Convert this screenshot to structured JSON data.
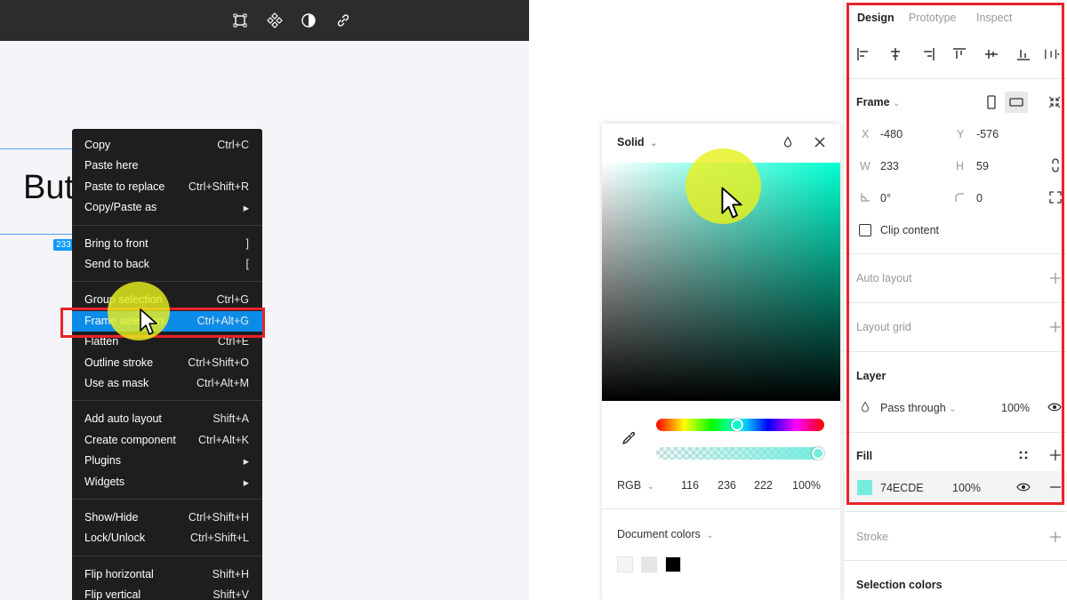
{
  "canvas": {
    "text": "But",
    "size_badge": "233"
  },
  "context_menu": {
    "groups": [
      [
        {
          "label": "Copy",
          "shortcut": "Ctrl+C"
        },
        {
          "label": "Paste here",
          "shortcut": ""
        },
        {
          "label": "Paste to replace",
          "shortcut": "Ctrl+Shift+R"
        },
        {
          "label": "Copy/Paste as",
          "shortcut": "▸"
        }
      ],
      [
        {
          "label": "Bring to front",
          "shortcut": "]"
        },
        {
          "label": "Send to back",
          "shortcut": "["
        }
      ],
      [
        {
          "label": "Group selection",
          "shortcut": "Ctrl+G"
        },
        {
          "label": "Frame selection",
          "shortcut": "Ctrl+Alt+G"
        },
        {
          "label": "Flatten",
          "shortcut": "Ctrl+E"
        },
        {
          "label": "Outline stroke",
          "shortcut": "Ctrl+Shift+O"
        },
        {
          "label": "Use as mask",
          "shortcut": "Ctrl+Alt+M"
        }
      ],
      [
        {
          "label": "Add auto layout",
          "shortcut": "Shift+A"
        },
        {
          "label": "Create component",
          "shortcut": "Ctrl+Alt+K"
        },
        {
          "label": "Plugins",
          "shortcut": "▸"
        },
        {
          "label": "Widgets",
          "shortcut": "▸"
        }
      ],
      [
        {
          "label": "Show/Hide",
          "shortcut": "Ctrl+Shift+H"
        },
        {
          "label": "Lock/Unlock",
          "shortcut": "Ctrl+Shift+L"
        }
      ],
      [
        {
          "label": "Flip horizontal",
          "shortcut": "Shift+H"
        },
        {
          "label": "Flip vertical",
          "shortcut": "Shift+V"
        }
      ]
    ],
    "highlighted": "Frame selection"
  },
  "color_picker": {
    "mode": "Solid",
    "color_model": "RGB",
    "r": "116",
    "g": "236",
    "b": "222",
    "alpha": "100%",
    "document_colors_label": "Document colors",
    "document_colors": [
      "#f5f5f5",
      "#e6e6e6",
      "#000000"
    ]
  },
  "design_panel": {
    "tabs": [
      "Design",
      "Prototype",
      "Inspect"
    ],
    "active_tab": "Design",
    "frame": {
      "label": "Frame",
      "x_label": "X",
      "x": "-480",
      "y_label": "Y",
      "y": "-576",
      "w_label": "W",
      "w": "233",
      "h_label": "H",
      "h": "59",
      "rotation": "0°",
      "radius": "0",
      "clip_content": "Clip content"
    },
    "auto_layout": "Auto layout",
    "layout_grid": "Layout grid",
    "layer": {
      "label": "Layer",
      "blend": "Pass through",
      "opacity": "100%"
    },
    "fill": {
      "label": "Fill",
      "hex": "74ECDE",
      "opacity": "100%",
      "color": "#74ecde"
    },
    "stroke": "Stroke",
    "selection_colors": "Selection colors"
  },
  "colors": {
    "highlight": "#0c8ce9",
    "annotation_red": "#e8232a",
    "cursor_glow": "#e8f01e"
  }
}
